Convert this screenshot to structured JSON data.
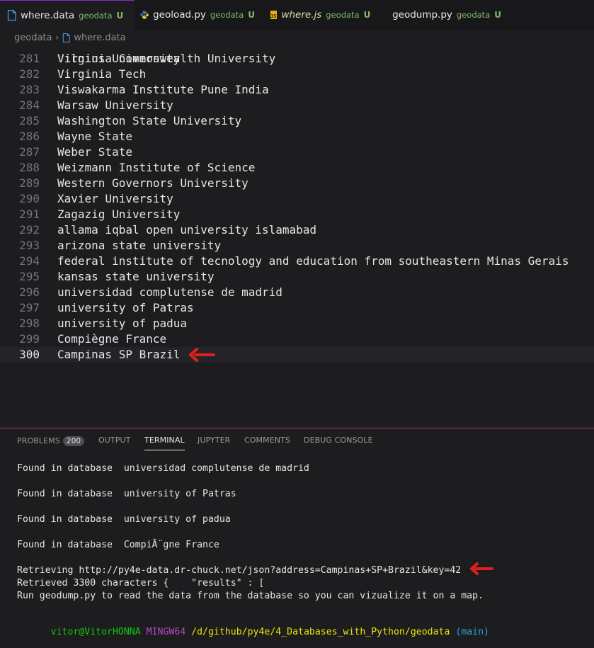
{
  "tabs": [
    {
      "name": "where.data",
      "folder": "geodata",
      "status": "U",
      "icon": "file-icon",
      "active": true
    },
    {
      "name": "geoload.py",
      "folder": "geodata",
      "status": "U",
      "icon": "python-icon"
    },
    {
      "name": "where.js",
      "folder": "geodata",
      "status": "U",
      "icon": "js-icon"
    },
    {
      "name": "geodump.py",
      "folder": "geodata",
      "status": "U",
      "icon": "python-icon"
    }
  ],
  "breadcrumb": {
    "folder": "geodata",
    "file": "where.data"
  },
  "editor": {
    "partial_line": "Vilnius University",
    "lines": [
      {
        "num": "281",
        "text": "Virginia Commonwealth University"
      },
      {
        "num": "282",
        "text": "Virginia Tech"
      },
      {
        "num": "283",
        "text": "Viswakarma Institute Pune India"
      },
      {
        "num": "284",
        "text": "Warsaw University"
      },
      {
        "num": "285",
        "text": "Washington State University"
      },
      {
        "num": "286",
        "text": "Wayne State"
      },
      {
        "num": "287",
        "text": "Weber State"
      },
      {
        "num": "288",
        "text": "Weizmann Institute of Science"
      },
      {
        "num": "289",
        "text": "Western Governors University"
      },
      {
        "num": "290",
        "text": "Xavier University"
      },
      {
        "num": "291",
        "text": "Zagazig University"
      },
      {
        "num": "292",
        "text": "allama iqbal open university islamabad"
      },
      {
        "num": "293",
        "text": "arizona state university"
      },
      {
        "num": "294",
        "text": "federal institute of tecnology and education from southeastern Minas Gerais"
      },
      {
        "num": "295",
        "text": "kansas state university"
      },
      {
        "num": "296",
        "text": "universidad complutense de madrid"
      },
      {
        "num": "297",
        "text": "university of Patras"
      },
      {
        "num": "298",
        "text": "university of padua"
      },
      {
        "num": "299",
        "text": "Compiègne France"
      },
      {
        "num": "300",
        "text": "Campinas SP Brazil",
        "current": true
      }
    ]
  },
  "panel": {
    "tabs": [
      {
        "label": "PROBLEMS",
        "badge": "200"
      },
      {
        "label": "OUTPUT"
      },
      {
        "label": "TERMINAL",
        "active": true
      },
      {
        "label": "JUPYTER"
      },
      {
        "label": "COMMENTS"
      },
      {
        "label": "DEBUG CONSOLE"
      }
    ]
  },
  "terminal": {
    "lines": [
      "Found in database  universidad complutense de madrid",
      "Found in database  university of Patras",
      "Found in database  university of padua",
      "Found in database  CompiÃ¨gne France",
      "Retrieving http://py4e-data.dr-chuck.net/json?address=Campinas+SP+Brazil&key=42",
      "Retrieved 3300 characters {    \"results\" : [",
      "Run geodump.py to read the data from the database so you can vizualize it on a map."
    ],
    "prompt": {
      "user": "vitor@VitorHONNA",
      "system": "MINGW64",
      "path": "/d/github/py4e/4_Databases_with_Python/geodata",
      "branch": "(main)"
    }
  },
  "colors": {
    "accent_border": "#c2207a",
    "annotation_arrow": "#e02020",
    "untracked_green": "#7fb86a"
  }
}
